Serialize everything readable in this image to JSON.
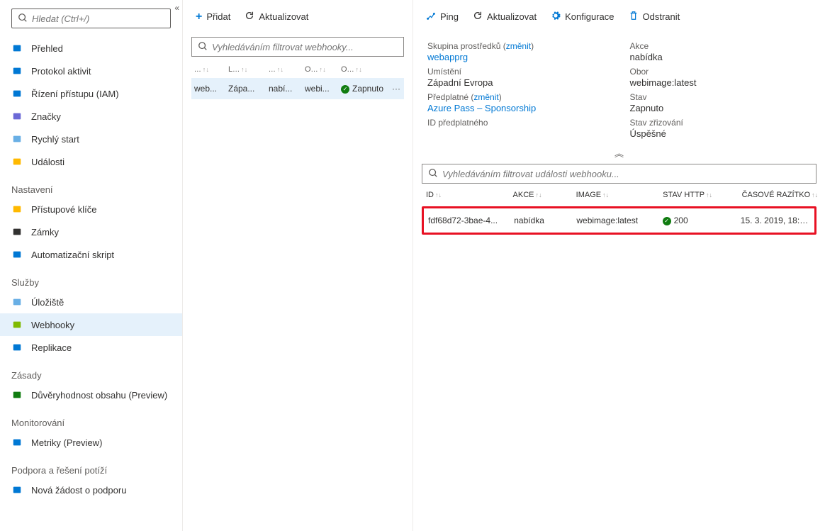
{
  "left": {
    "search_placeholder": "Hledat (Ctrl+/)",
    "items_top": [
      {
        "icon_color": "#0078d4",
        "label": "Přehled"
      },
      {
        "icon_color": "#0078d4",
        "label": "Protokol aktivit"
      },
      {
        "icon_color": "#0078d4",
        "label": "Řízení přístupu (IAM)"
      },
      {
        "icon_color": "#6b69d6",
        "label": "Značky"
      },
      {
        "icon_color": "#69afe5",
        "label": "Rychlý start"
      },
      {
        "icon_color": "#ffb900",
        "label": "Události"
      }
    ],
    "section_settings": "Nastavení",
    "items_settings": [
      {
        "icon_color": "#ffb900",
        "label": "Přístupové klíče"
      },
      {
        "icon_color": "#323130",
        "label": "Zámky"
      },
      {
        "icon_color": "#0078d4",
        "label": "Automatizační skript"
      }
    ],
    "section_services": "Služby",
    "items_services": [
      {
        "icon_color": "#69afe5",
        "label": "Úložiště"
      },
      {
        "icon_color": "#7fba00",
        "label": "Webhooky"
      },
      {
        "icon_color": "#0078d4",
        "label": "Replikace"
      }
    ],
    "section_policies": "Zásady",
    "items_policies": [
      {
        "icon_color": "#107c10",
        "label": "Důvěryhodnost obsahu (Preview)"
      }
    ],
    "section_monitoring": "Monitorování",
    "items_monitoring": [
      {
        "icon_color": "#0078d4",
        "label": "Metriky (Preview)"
      }
    ],
    "section_support": "Podpora a řešení potíží",
    "items_support": [
      {
        "icon_color": "#0078d4",
        "label": "Nová žádost o podporu"
      }
    ]
  },
  "mid": {
    "toolbar": {
      "add": "Přidat",
      "refresh": "Aktualizovat"
    },
    "filter_placeholder": "Vyhledáváním filtrovat webhooky...",
    "headers": [
      "...",
      "L...",
      "...",
      "O...",
      "O..."
    ],
    "row": {
      "c1": "web...",
      "c2": "Zápa...",
      "c3": "nabí...",
      "c4": "webi...",
      "c5": "Zapnuto"
    }
  },
  "right": {
    "toolbar": {
      "ping": "Ping",
      "refresh": "Aktualizovat",
      "config": "Konfigurace",
      "delete": "Odstranit"
    },
    "kv_left": [
      {
        "label": "Skupina prostředků",
        "change": "změnit",
        "value": "webapprg",
        "value_link": true
      },
      {
        "label": "Umístění",
        "value": "Západní Evropa"
      },
      {
        "label": "Předplatné",
        "change": "změnit",
        "value": "Azure Pass – Sponsorship",
        "value_link": true
      },
      {
        "label": "ID předplatného",
        "value": ""
      }
    ],
    "kv_right": [
      {
        "label": "Akce",
        "value": "nabídka"
      },
      {
        "label": "Obor",
        "value": "webimage:latest"
      },
      {
        "label": "Stav",
        "value": "Zapnuto"
      },
      {
        "label": "Stav zřizování",
        "value": "Úspěšné"
      }
    ],
    "events_filter_placeholder": "Vyhledáváním filtrovat události webhooku...",
    "events_headers": [
      "ID",
      "AKCE",
      "IMAGE",
      "STAV HTTP",
      "ČASOVÉ RAZÍTKO"
    ],
    "event_row": {
      "id": "fdf68d72-3bae-4...",
      "action": "nabídka",
      "image": "webimage:latest",
      "status": "200",
      "ts": "15. 3. 2019, 18:26..."
    }
  }
}
